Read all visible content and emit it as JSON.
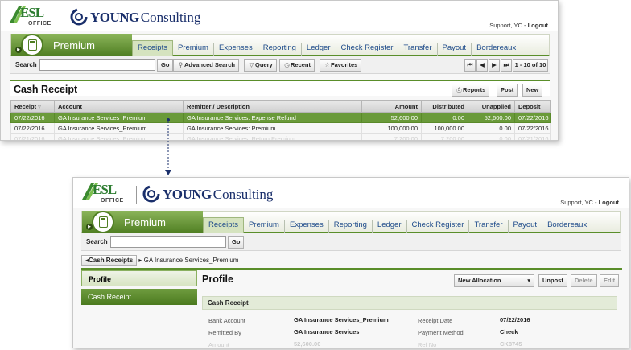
{
  "brand": {
    "esl": "ESL",
    "esl_sub": "OFFICE",
    "young": "YOUNG",
    "consulting": "Consulting"
  },
  "user": {
    "name": "Support, YC",
    "sep": " - ",
    "logout": "Logout"
  },
  "module": {
    "title": "Premium",
    "play_glyph": "▶"
  },
  "nav_tabs": [
    {
      "label": "Receipts",
      "active": true
    },
    {
      "label": "Premium"
    },
    {
      "label": "Expenses"
    },
    {
      "label": "Reporting"
    },
    {
      "label": "Ledger"
    },
    {
      "label": "Check Register"
    },
    {
      "label": "Transfer"
    },
    {
      "label": "Payout"
    },
    {
      "label": "Bordereaux"
    }
  ],
  "search": {
    "label": "Search",
    "value": "",
    "go": "Go"
  },
  "toolbar1": {
    "advanced": "Advanced Search",
    "query": "Query",
    "recent": "Recent",
    "favorites": "Favorites",
    "paging": "1 - 10 of 10"
  },
  "list": {
    "title": "Cash Receipt",
    "buttons": {
      "reports": "Reports",
      "post": "Post",
      "new": "New"
    },
    "columns": [
      "Receipt",
      "Account",
      "Remitter / Description",
      "Amount",
      "Distributed",
      "Unapplied",
      "Deposit"
    ],
    "rows": [
      [
        "07/22/2016",
        "GA Insurance Services_Premium",
        "GA Insurance Services: Expense Refund",
        "52,600.00",
        "0.00",
        "52,600.00",
        "07/22/2016"
      ],
      [
        "07/22/2016",
        "GA Insurance Services_Premium",
        "GA Insurance Services: Premium",
        "100,000.00",
        "100,000.00",
        "0.00",
        "07/22/2016"
      ],
      [
        "07/21/2016",
        "GA Insurance Services_Premium",
        "GA Insurance Services: Return Premium",
        "7,200.00",
        "7,200.00",
        "0.00",
        "07/21/2016"
      ]
    ]
  },
  "breadcrumb": {
    "back": "Cash Receipts",
    "current": "GA Insurance Services_Premium"
  },
  "sidebar": {
    "items": [
      {
        "label": "Profile",
        "active": true
      },
      {
        "label": "Cash Receipt"
      }
    ]
  },
  "profile": {
    "title": "Profile",
    "allocation": "New Allocation",
    "unpost": "Unpost",
    "delete": "Delete",
    "edit": "Edit",
    "section": "Cash Receipt",
    "fields_left": [
      {
        "label": "Bank Account",
        "value": "GA Insurance Services_Premium"
      },
      {
        "label": "Remitted By",
        "value": "GA Insurance Services"
      },
      {
        "label": "Amount",
        "value": "52,600.00"
      }
    ],
    "fields_right": [
      {
        "label": "Receipt Date",
        "value": "07/22/2016"
      },
      {
        "label": "Payment Method",
        "value": "Check"
      },
      {
        "label": "Ref No",
        "value": "CK8745"
      }
    ]
  },
  "colors": {
    "accent": "#5a8e2a",
    "selected_row": "#6a9a3a",
    "link": "#1d4a8a",
    "navy": "#1a2f6b"
  },
  "icons": {
    "advanced": "search-icon",
    "query": "funnel-icon",
    "recent": "clock-icon",
    "favorites": "star-icon",
    "reports": "printer-icon",
    "sort": "sort-desc-icon",
    "back": "triangle-left-icon",
    "crumb": "triangle-right-icon",
    "dropdown": "chevron-down-icon",
    "paging_first": "first-page-icon",
    "paging_prev": "prev-page-icon",
    "paging_next": "next-page-icon",
    "paging_last": "last-page-icon"
  }
}
